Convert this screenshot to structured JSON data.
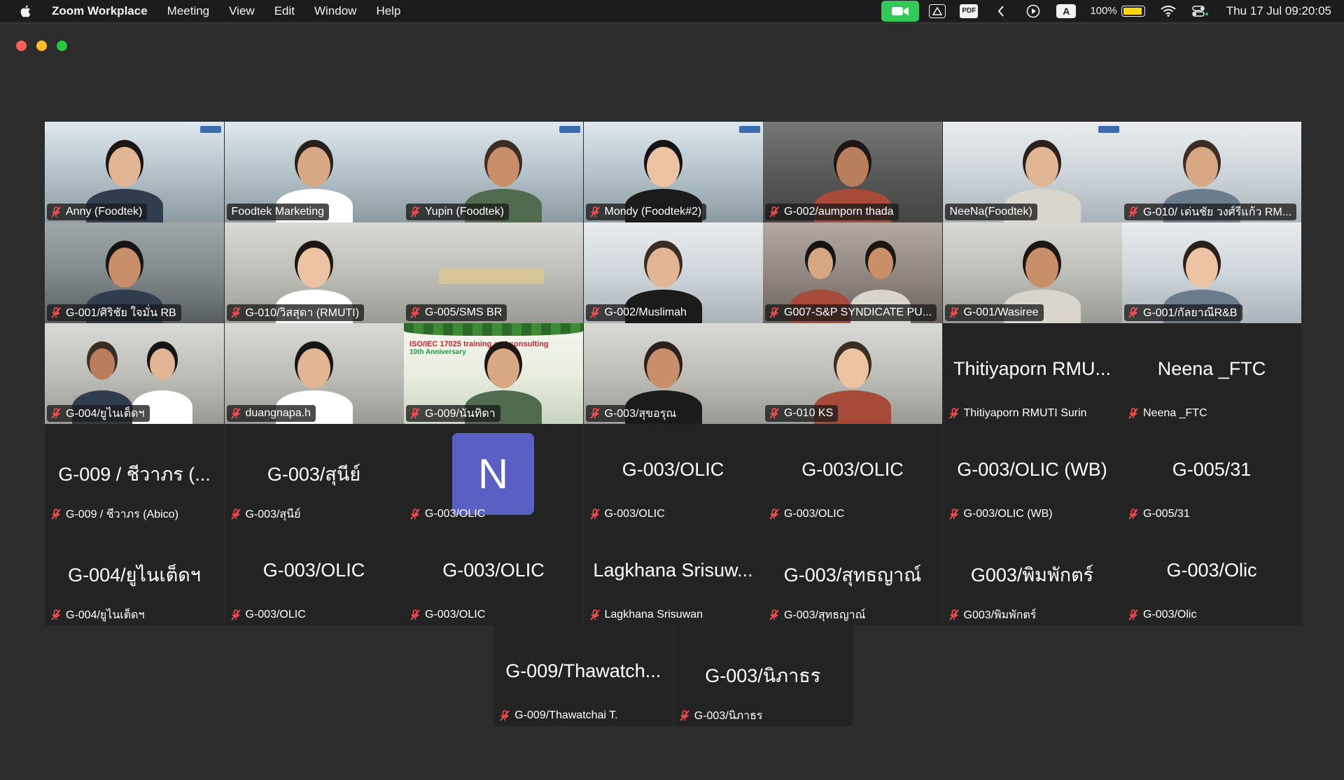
{
  "menubar": {
    "app_name": "Zoom Workplace",
    "menus": [
      "Meeting",
      "View",
      "Edit",
      "Window",
      "Help"
    ],
    "status_icons": [
      "zoom-camera-icon",
      "drive-icon",
      "pdf-icon",
      "chevron-left-icon",
      "play-icon",
      "input-source-icon",
      "battery-icon",
      "wifi-icon",
      "control-center-icon"
    ],
    "pdf_label": "PDF",
    "input_label": "A",
    "battery_percent": "100%",
    "datetime": "Thu 17 Jul  09:20:05",
    "accent_green": "#34c759"
  },
  "gallery": {
    "active_speaker_color": "#2fb24c",
    "avatar_color": "#5a5fc4",
    "row1": [
      {
        "name": "Anny (Foodtek)",
        "muted": true
      },
      {
        "name": "Foodtek Marketing",
        "muted": false
      },
      {
        "name": "Yupin (Foodtek)",
        "muted": true
      },
      {
        "name": "Mondy (Foodtek#2)",
        "muted": true
      },
      {
        "name": "G-002/aumporn thada",
        "muted": true
      },
      {
        "name": "NeeNa(Foodtek)",
        "muted": false
      },
      {
        "name": "G-010/ เด่นชัย วงศ์รีแก้ว RM...",
        "muted": true
      }
    ],
    "row2": [
      {
        "name": "G-001/ศิริชัย ใจมั่น RB",
        "muted": true
      },
      {
        "name": "G-010/วิสสุดา (RMUTI)",
        "muted": true
      },
      {
        "name": "G-005/SMS BR",
        "muted": true
      },
      {
        "name": "G-002/Muslimah",
        "muted": true
      },
      {
        "name": "G007-S&P SYNDICATE PU...",
        "muted": true
      },
      {
        "name": "G-001/Wasiree",
        "muted": true
      },
      {
        "name": "G-001/กัลยาณีR&B",
        "muted": true
      }
    ],
    "row3": [
      {
        "name": "G-004/ยูไนเต็ดฯ",
        "muted": true
      },
      {
        "name": "duangnapa.h",
        "muted": true
      },
      {
        "name": "G-009/นันทิดา",
        "muted": true,
        "banner_line1": "ISO/IEC 17025 training and consulting",
        "banner_line2": "10th Anniversary"
      },
      {
        "name": "G-003/สุขอรุณ",
        "muted": true
      },
      {
        "name": "G-010 KS",
        "muted": true
      },
      {
        "big": "Thitiyaporn RMU...",
        "name": "Thitiyaporn RMUTI Surin",
        "muted": true
      },
      {
        "big": "Neena _FTC",
        "name": "Neena _FTC",
        "muted": true
      }
    ],
    "row4": [
      {
        "big": "G-009 / ชีวาภร (...",
        "name": "G-009 / ชีวาภร (Abico)",
        "muted": true
      },
      {
        "big": "G-003/สุนีย์",
        "name": "G-003/สุนีย์",
        "muted": true
      },
      {
        "initial": "N",
        "name": "G-003/OLIC",
        "muted": true
      },
      {
        "big": "G-003/OLIC",
        "name": "G-003/OLIC",
        "muted": true
      },
      {
        "big": "G-003/OLIC",
        "name": "G-003/OLIC",
        "muted": true
      },
      {
        "big": "G-003/OLIC (WB)",
        "name": "G-003/OLIC (WB)",
        "muted": true
      },
      {
        "big": "G-005/31",
        "name": "G-005/31",
        "muted": true
      }
    ],
    "row5": [
      {
        "big": "G-004/ยูไนเต็ดฯ",
        "name": "G-004/ยูไนเต็ดฯ",
        "muted": true
      },
      {
        "big": "G-003/OLIC",
        "name": "G-003/OLIC",
        "muted": true
      },
      {
        "big": "G-003/OLIC",
        "name": "G-003/OLIC",
        "muted": true
      },
      {
        "big": "Lagkhana Srisuw...",
        "name": "Lagkhana Srisuwan",
        "muted": true
      },
      {
        "big": "G-003/สุทธญาณ์",
        "name": "G-003/สุทธญาณ์",
        "muted": true
      },
      {
        "big": "G003/พิมพักตร์",
        "name": "G003/พิมพักตร์",
        "muted": true
      },
      {
        "big": "G-003/Olic",
        "name": "G-003/Olic",
        "muted": true
      }
    ],
    "row6": [
      {
        "big": "G-009/Thawatch...",
        "name": "G-009/Thawatchai T.",
        "muted": true
      },
      {
        "big": "G-003/นิภาธร",
        "name": "G-003/นิภาธร",
        "muted": true
      }
    ]
  }
}
